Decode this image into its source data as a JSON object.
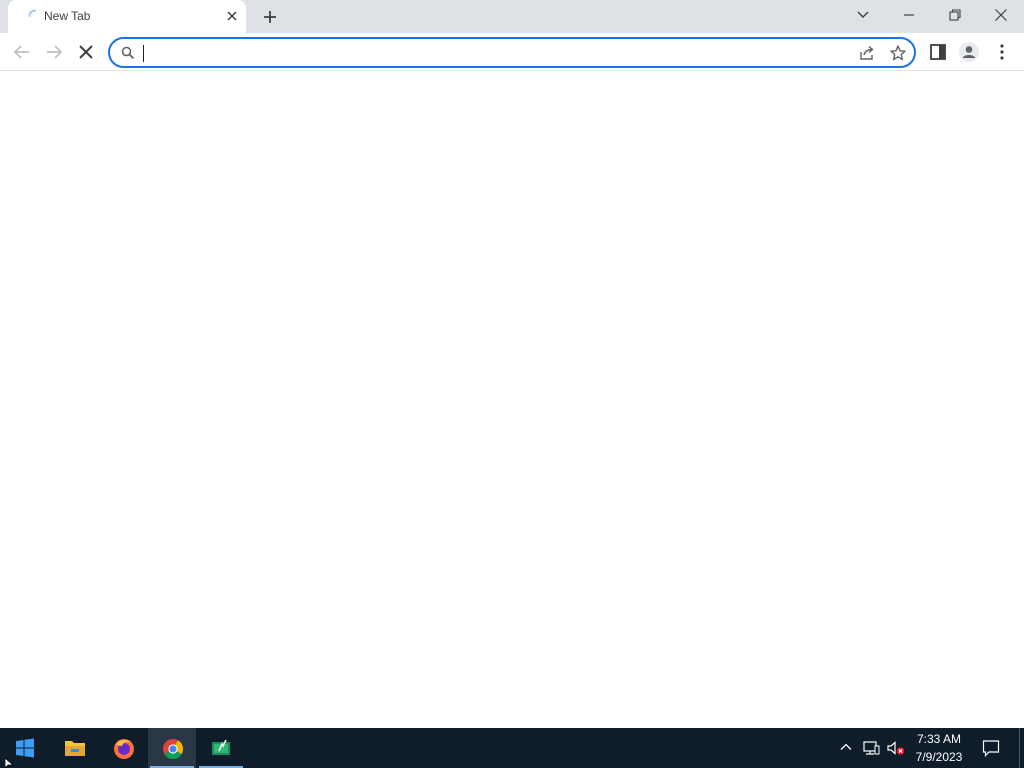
{
  "browser": {
    "tab": {
      "title": "New Tab",
      "loading": true,
      "spinner_icon": "loading-spinner-icon",
      "close_icon": "close-icon"
    },
    "new_tab_icon": "plus-icon",
    "window_controls": {
      "tab_search_icon": "chevron-down-icon",
      "minimize_icon": "minimize-icon",
      "restore_icon": "restore-icon",
      "close_icon": "close-icon"
    },
    "toolbar": {
      "back_icon": "arrow-left-icon",
      "forward_icon": "arrow-right-icon",
      "stop_icon": "stop-x-icon",
      "address": {
        "value": "",
        "placeholder": "",
        "search_icon": "search-icon",
        "share_icon": "share-icon",
        "bookmark_icon": "star-icon"
      },
      "side_panel_icon": "side-panel-icon",
      "profile_icon": "profile-icon",
      "menu_icon": "kebab-menu-icon"
    },
    "accent_color": "#1a73e8"
  },
  "taskbar": {
    "start_icon": "windows-logo-icon",
    "apps": [
      {
        "name": "File Explorer",
        "icon": "folder-icon",
        "active": false,
        "open": false
      },
      {
        "name": "Firefox",
        "icon": "firefox-icon",
        "active": false,
        "open": false
      },
      {
        "name": "Google Chrome",
        "icon": "chrome-icon",
        "active": true,
        "open": true
      },
      {
        "name": "App",
        "icon": "app-icon",
        "active": false,
        "open": true
      }
    ],
    "tray": {
      "overflow_icon": "chevron-up-icon",
      "network_icon": "network-icon",
      "volume_icon": "volume-muted-icon"
    },
    "clock": {
      "time": "7:33 AM",
      "date": "7/9/2023"
    },
    "notification_icon": "notification-icon",
    "background_color": "#0f1c2a"
  }
}
